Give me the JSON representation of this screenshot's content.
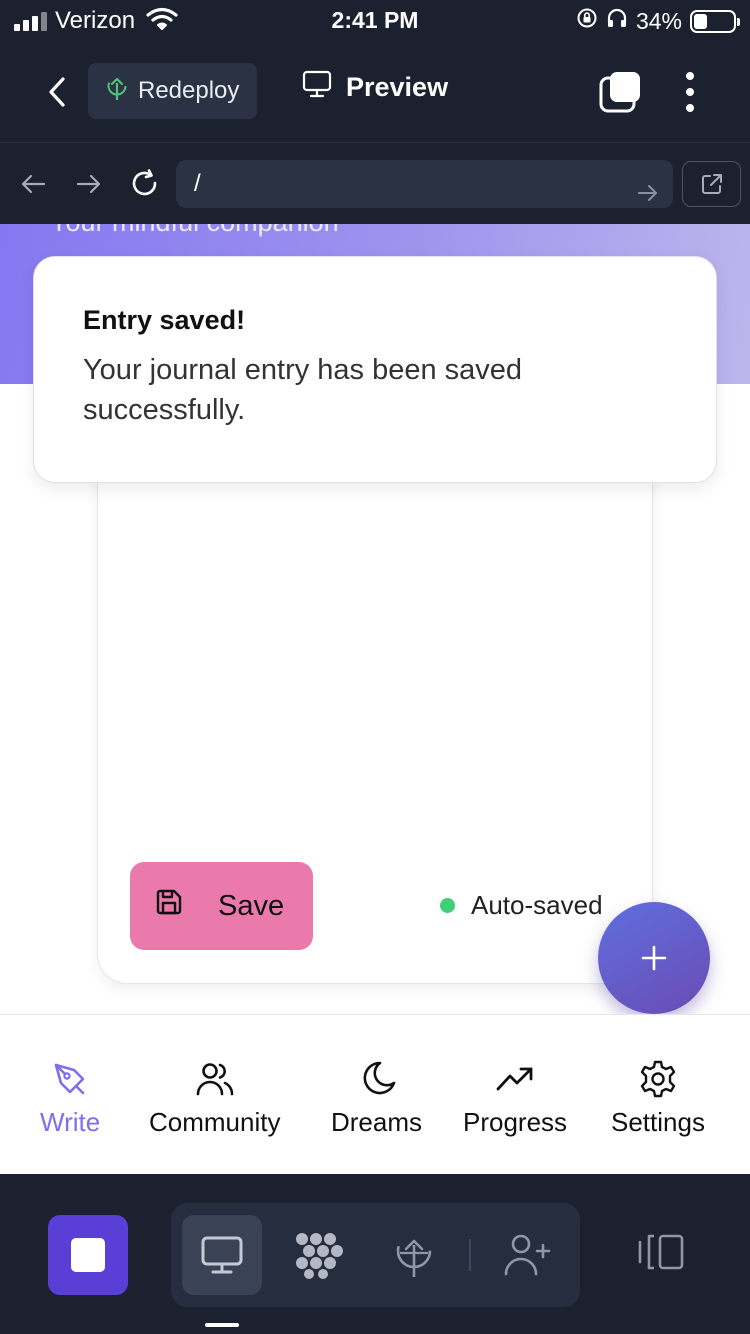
{
  "status": {
    "carrier": "Verizon",
    "time": "2:41 PM",
    "battery": "34%",
    "battery_level": 0.34
  },
  "header": {
    "redeploy_label": "Redeploy",
    "preview_label": "Preview"
  },
  "browser": {
    "url": "/"
  },
  "hero": {
    "subtitle": "Your mindful companion"
  },
  "toast": {
    "title": "Entry saved!",
    "message": "Your journal entry has been saved successfully."
  },
  "editor": {
    "save_label": "Save",
    "autosave_status": "Auto-saved"
  },
  "tabbar": {
    "items": [
      {
        "label": "Write",
        "icon": "pen-icon",
        "active": true
      },
      {
        "label": "Community",
        "icon": "users-icon",
        "active": false
      },
      {
        "label": "Dreams",
        "icon": "moon-icon",
        "active": false
      },
      {
        "label": "Progress",
        "icon": "trending-up-icon",
        "active": false
      },
      {
        "label": "Settings",
        "icon": "gear-icon",
        "active": false
      }
    ]
  },
  "colors": {
    "accent": "#7c6ff0",
    "save_button": "#e97aab",
    "status_dot": "#3fcf74",
    "dark_bg": "#1c2130"
  }
}
